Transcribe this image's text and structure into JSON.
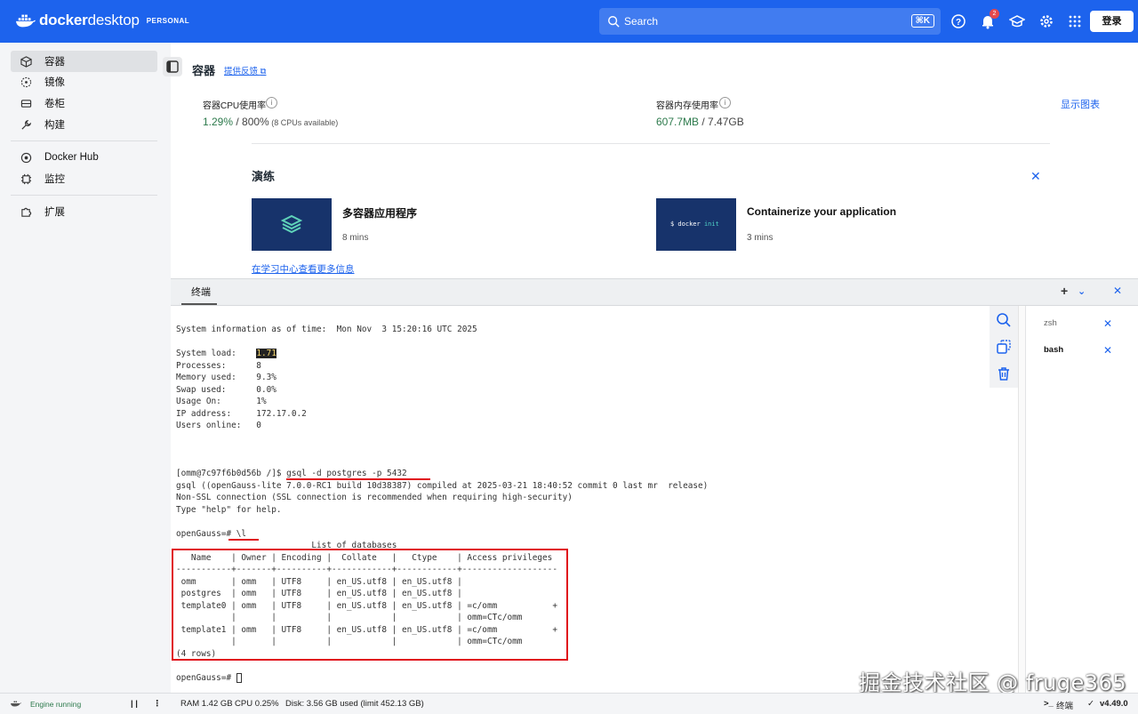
{
  "topbar": {
    "brand_bold": "docker",
    "brand_light": "desktop",
    "tier": "PERSONAL",
    "search_placeholder": "Search",
    "search_shortcut": "⌘K",
    "notification_count": "2",
    "login_label": "登录",
    "accent": "#1d63ed"
  },
  "sidebar": {
    "items": [
      {
        "label": "容器",
        "icon": "container-icon"
      },
      {
        "label": "镜像",
        "icon": "image-icon"
      },
      {
        "label": "卷柜",
        "icon": "volume-icon"
      },
      {
        "label": "构建",
        "icon": "wrench-icon"
      },
      {
        "label": "Docker Hub",
        "icon": "hub-icon"
      },
      {
        "label": "监控",
        "icon": "monitor-icon"
      },
      {
        "label": "扩展",
        "icon": "puzzle-icon"
      }
    ]
  },
  "page": {
    "title": "容器",
    "feedback": "提供反馈",
    "cpu_label": "容器CPU使用率",
    "cpu_value": "1.29%",
    "cpu_total": " / 800%",
    "cpu_note": " (8 CPUs available)",
    "mem_label": "容器内存使用率",
    "mem_value": "607.7MB",
    "mem_total": " / 7.47GB",
    "show_chart": "显示图表"
  },
  "learning": {
    "title": "演练",
    "cards": [
      {
        "title": "多容器应用程序",
        "meta": "8 mins"
      },
      {
        "title": "Containerize your application",
        "meta": "3 mins",
        "code_prefix": "$ docker ",
        "code_cmd": "init"
      }
    ],
    "link": "在学习中心查看更多信息"
  },
  "terminal": {
    "tab": "终端",
    "sysinfo": "System information as of time:  Mon Nov  3 15:20:16 UTC 2025",
    "load_label": "System load:    ",
    "load_value": "1.71",
    "stats": "Processes:      8\nMemory used:    9.3%\nSwap used:      0.0%\nUsage On:       1%\nIP address:     172.17.0.2\nUsers online:   0",
    "prompt1": "[omm@7c97f6b0d56b /]$ gsql -d postgres -p 5432",
    "gsql_info": "gsql ((openGauss-lite 7.0.0-RC1 build 10d38387) compiled at 2025-03-21 18:40:52 commit 0 last mr  release)\nNon-SSL connection (SSL connection is recommended when requiring high-security)\nType \"help\" for help.",
    "prompt2": "openGauss=# \\l",
    "db_title": "                           List of databases",
    "db_table": "   Name    | Owner | Encoding |  Collate   |   Ctype    | Access privileges\n-----------+-------+----------+------------+------------+-------------------\n omm       | omm   | UTF8     | en_US.utf8 | en_US.utf8 |\n postgres  | omm   | UTF8     | en_US.utf8 | en_US.utf8 |\n template0 | omm   | UTF8     | en_US.utf8 | en_US.utf8 | =c/omm           +\n           |       |          |            |            | omm=CTc/omm\n template1 | omm   | UTF8     | en_US.utf8 | en_US.utf8 | =c/omm           +\n           |       |          |            |            | omm=CTc/omm\n(4 rows)",
    "prompt3": "openGauss=# ",
    "sessions": [
      "zsh",
      "bash"
    ]
  },
  "statusbar": {
    "engine": "Engine running",
    "ram": "RAM 1.42 GB",
    "cpu": "CPU 0.25%",
    "disk": "Disk: 3.56 GB used (limit 452.13 GB)",
    "terminal": "终端",
    "version": "v4.49.0"
  },
  "watermark": "掘金技术社区 @ fruge365"
}
